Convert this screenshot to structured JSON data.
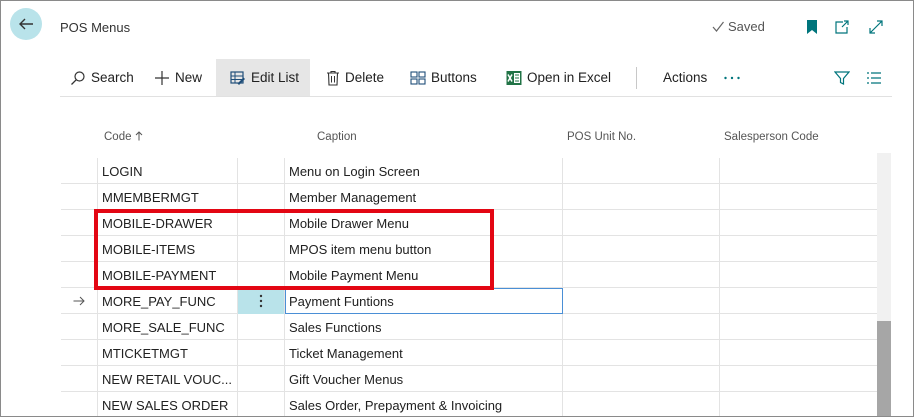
{
  "header": {
    "title": "POS Menus",
    "saved_label": "Saved"
  },
  "actions": {
    "search": "Search",
    "new": "New",
    "edit_list": "Edit List",
    "delete": "Delete",
    "buttons": "Buttons",
    "open_in_excel": "Open in Excel",
    "actions": "Actions"
  },
  "columns": {
    "code": "Code",
    "caption": "Caption",
    "pos_unit": "POS Unit No.",
    "salesperson": "Salesperson Code"
  },
  "rows": [
    {
      "code": "LOGIN",
      "caption": "Menu on Login Screen"
    },
    {
      "code": "MMEMBERMGT",
      "caption": "Member Management"
    },
    {
      "code": "MOBILE-DRAWER",
      "caption": "Mobile Drawer Menu"
    },
    {
      "code": "MOBILE-ITEMS",
      "caption": "MPOS item menu button"
    },
    {
      "code": "MOBILE-PAYMENT",
      "caption": "Mobile Payment Menu"
    },
    {
      "code": "MORE_PAY_FUNC",
      "caption": "Payment Funtions"
    },
    {
      "code": "MORE_SALE_FUNC",
      "caption": "Sales Functions"
    },
    {
      "code": "MTICKETMGT",
      "caption": "Ticket Management"
    },
    {
      "code": "NEW RETAIL VOUC...",
      "caption": "Gift Voucher Menus"
    },
    {
      "code": "NEW SALES ORDER",
      "caption": "Sales Order, Prepayment & Invoicing"
    }
  ],
  "selected_row_index": 5,
  "icons": {
    "back": "arrow-left-icon",
    "saved": "checkmark-icon",
    "bookmark": "bookmark-icon",
    "share": "share-icon",
    "expand": "expand-icon",
    "search": "magnifier-icon",
    "new": "plus-icon",
    "edit_list": "edit-list-icon",
    "delete": "trash-icon",
    "buttons": "buttons-icon",
    "excel": "excel-icon",
    "more": "more-icon",
    "filter": "filter-icon",
    "list_view": "list-view-icon",
    "row_marker": "arrow-right-icon",
    "row_menu": "vertical-dots-icon"
  },
  "colors": {
    "accent": "#b9e3ea",
    "highlight_box": "#e30613",
    "bookmark": "#00757c",
    "excel": "#217346"
  }
}
